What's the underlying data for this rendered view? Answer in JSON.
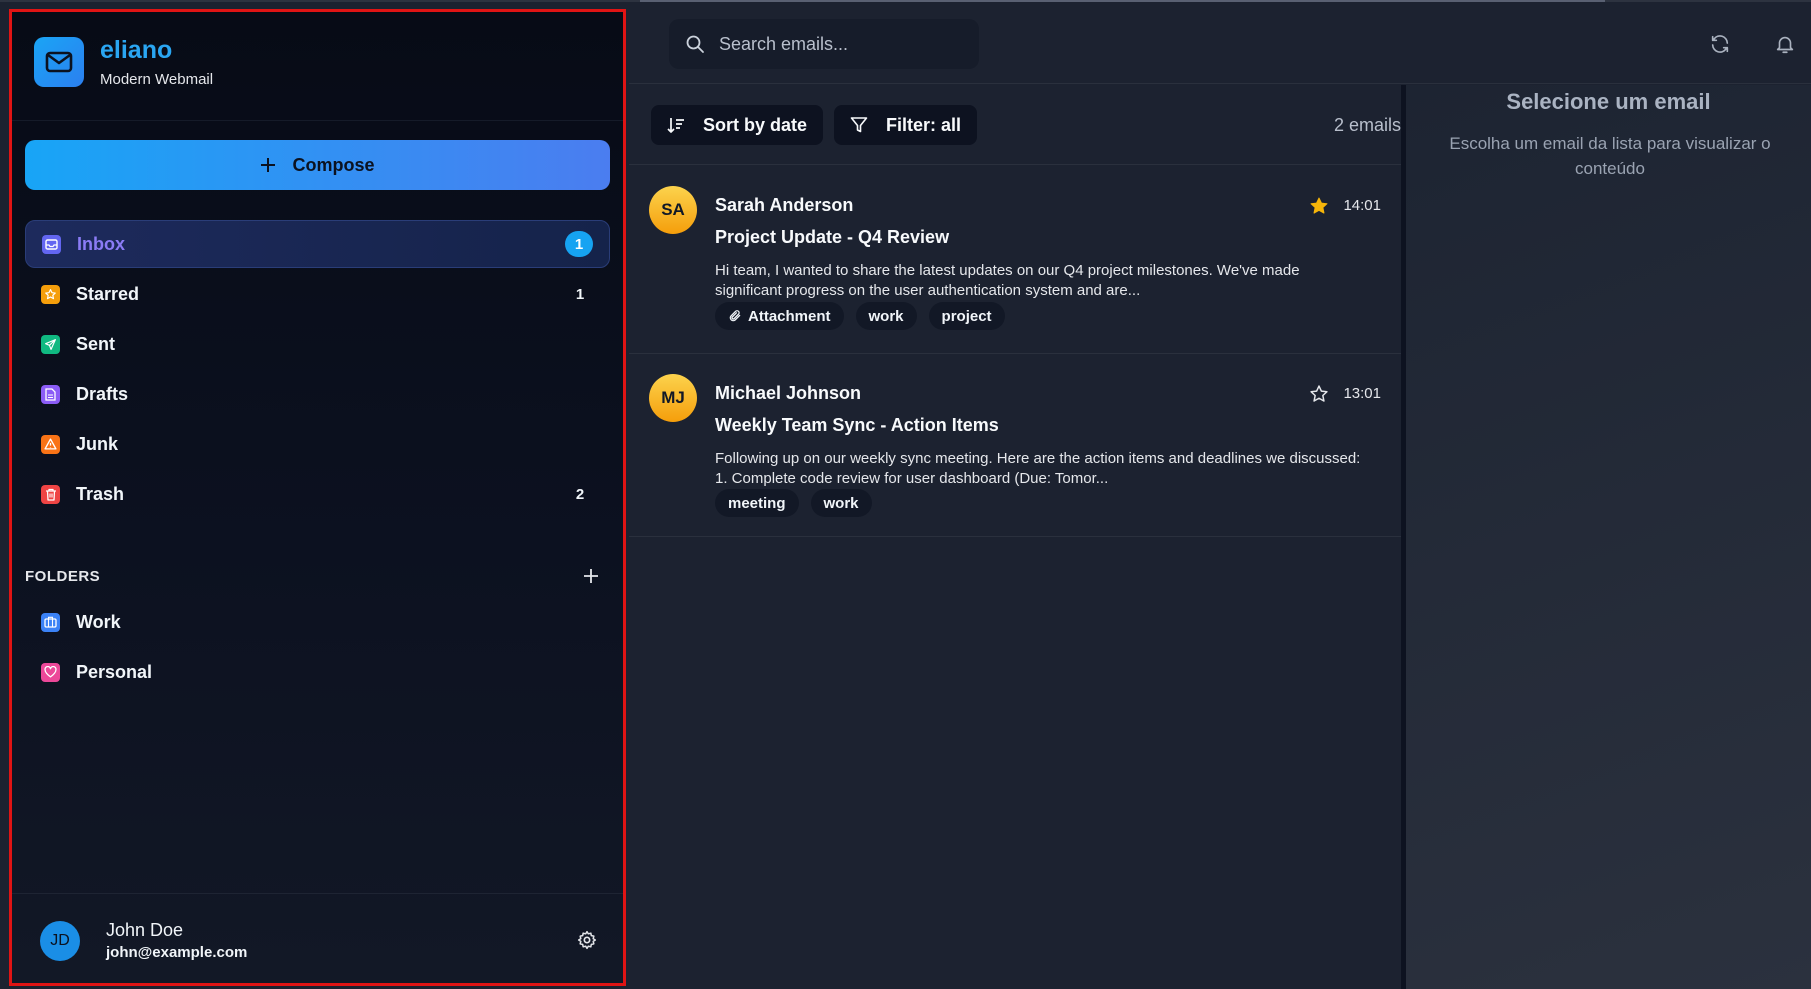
{
  "app": {
    "name": "eliano",
    "subtitle": "Modern Webmail"
  },
  "compose_label": "Compose",
  "nav": [
    {
      "label": "Inbox",
      "count": "1",
      "icon": "inbox-icon",
      "color": "#6366f1"
    },
    {
      "label": "Starred",
      "count": "1",
      "icon": "star-icon",
      "color": "#f59e0b"
    },
    {
      "label": "Sent",
      "count": "",
      "icon": "send-icon",
      "color": "#10b981"
    },
    {
      "label": "Drafts",
      "count": "",
      "icon": "draft-icon",
      "color": "#8b5cf6"
    },
    {
      "label": "Junk",
      "count": "",
      "icon": "warning-icon",
      "color": "#f97316"
    },
    {
      "label": "Trash",
      "count": "2",
      "icon": "trash-icon",
      "color": "#ef4444"
    }
  ],
  "folders": {
    "title": "FOLDERS",
    "items": [
      {
        "label": "Work",
        "icon": "briefcase-icon",
        "color": "#3b82f6"
      },
      {
        "label": "Personal",
        "icon": "heart-icon",
        "color": "#ec4899"
      }
    ]
  },
  "user": {
    "initials": "JD",
    "name": "John Doe",
    "email": "john@example.com"
  },
  "search": {
    "placeholder": "Search emails..."
  },
  "toolbar": {
    "sort_label": "Sort by date",
    "filter_label": "Filter: all",
    "count_text": "2 emails"
  },
  "emails": [
    {
      "initials": "SA",
      "sender": "Sarah Anderson",
      "subject": "Project Update - Q4 Review",
      "preview": "Hi team, I wanted to share the latest updates on our Q4 project milestones. We've made significant progress on the user authentication system and are...",
      "time": "14:01",
      "starred": true,
      "attachment_label": "Attachment",
      "tags": [
        "work",
        "project"
      ]
    },
    {
      "initials": "MJ",
      "sender": "Michael Johnson",
      "subject": "Weekly Team Sync - Action Items",
      "preview": "Following up on our weekly sync meeting. Here are the action items and deadlines we discussed: 1. Complete code review for user dashboard (Due: Tomor...",
      "time": "13:01",
      "starred": false,
      "tags": [
        "meeting",
        "work"
      ]
    }
  ],
  "reader": {
    "title": "Selecione um email",
    "subtitle": "Escolha um email da lista para visualizar o conteúdo"
  },
  "colors": {
    "accent": "#16a3f2",
    "sidebar_border": "#e01414",
    "star": "#f5b50a"
  }
}
